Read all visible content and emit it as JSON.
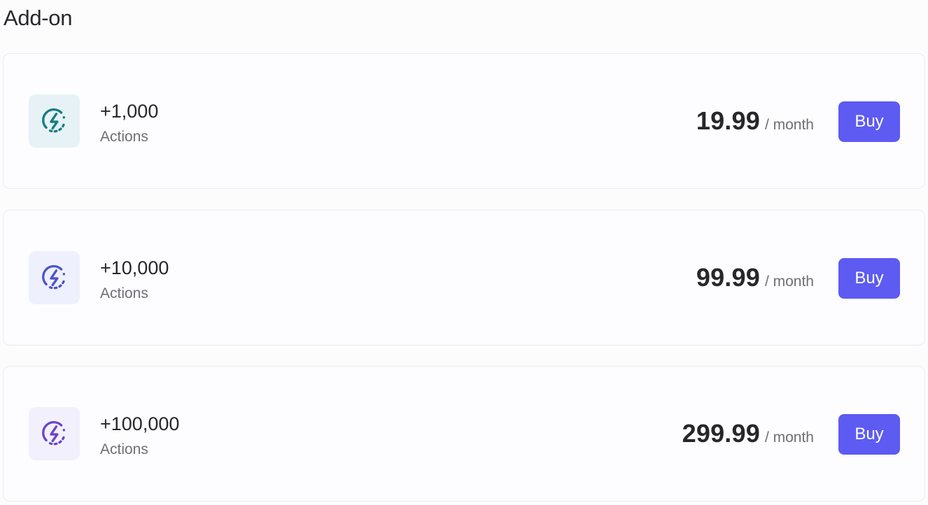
{
  "section": {
    "title": "Add-on"
  },
  "addons": [
    {
      "amount": "+1,000",
      "unit": "Actions",
      "price": "19.99",
      "period": "/ month",
      "buy_label": "Buy",
      "icon": "bolt-icon",
      "icon_color": "#157c82",
      "icon_bg": "#e6f2f6"
    },
    {
      "amount": "+10,000",
      "unit": "Actions",
      "price": "99.99",
      "period": "/ month",
      "buy_label": "Buy",
      "icon": "bolt-icon",
      "icon_color": "#4a55c9",
      "icon_bg": "#eff0fd"
    },
    {
      "amount": "+100,000",
      "unit": "Actions",
      "price": "299.99",
      "period": "/ month",
      "buy_label": "Buy",
      "icon": "bolt-icon",
      "icon_color": "#6a45c6",
      "icon_bg": "#f3f0fd"
    }
  ],
  "colors": {
    "accent": "#5d5bf2",
    "text": "#27262b",
    "muted": "#706d78"
  }
}
